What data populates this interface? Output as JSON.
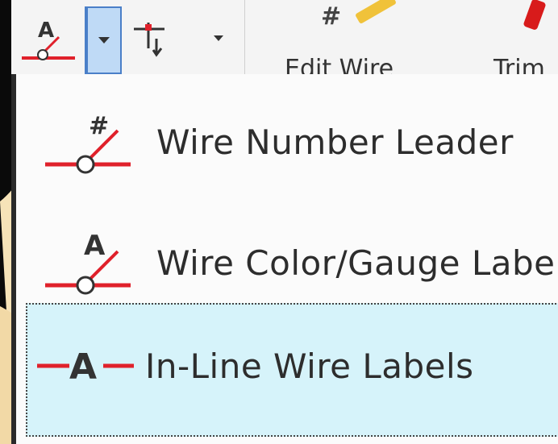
{
  "ribbon": {
    "edit_wire_label": "Edit Wire",
    "trim_label": "Trim"
  },
  "menu": {
    "items": [
      {
        "label": "Wire Number Leader",
        "icon": "wire-number-leader-icon",
        "selected": false
      },
      {
        "label": "Wire Color/Gauge Labels",
        "icon": "wire-color-gauge-labels-icon",
        "selected": false
      },
      {
        "label": "In-Line Wire Labels",
        "icon": "inline-wire-labels-icon",
        "selected": true
      }
    ]
  },
  "colors": {
    "wire_red": "#e0212b",
    "selection_bg": "#d6f3fa",
    "split_button_border": "#4a7fc8"
  }
}
